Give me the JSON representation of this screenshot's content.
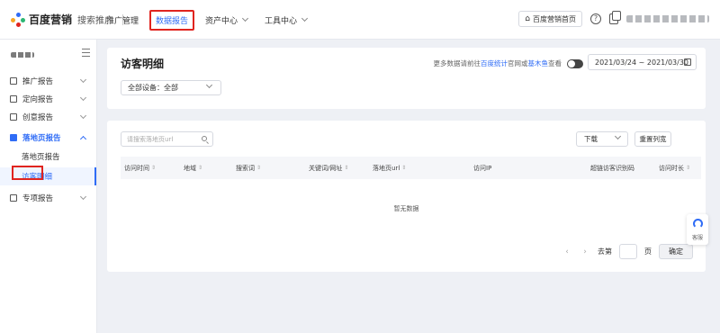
{
  "brand": {
    "name": "百度营销",
    "sub": "搜索推广",
    "colors": {
      "blue": "#2f6cf6",
      "red": "#e0241f",
      "green": "#2bb673",
      "orange": "#f6a623"
    }
  },
  "topnav": {
    "items": [
      {
        "label": "推广管理",
        "has_dropdown": false
      },
      {
        "label": "数据报告",
        "has_dropdown": false,
        "active": true
      },
      {
        "label": "资产中心",
        "has_dropdown": true
      },
      {
        "label": "工具中心",
        "has_dropdown": true
      }
    ],
    "home_label": "百度营销首页",
    "help_icon": "help-icon",
    "copy_icon": "copy-icon"
  },
  "sidebar": {
    "items": [
      {
        "label": "推广报告",
        "icon": "report-icon"
      },
      {
        "label": "定向报告",
        "icon": "target-icon"
      },
      {
        "label": "创意报告",
        "icon": "creative-icon"
      },
      {
        "label": "落地页报告",
        "icon": "landing-icon",
        "open": true
      },
      {
        "label": "专项报告",
        "icon": "special-icon"
      }
    ],
    "subitems": [
      {
        "label": "落地页报告"
      },
      {
        "label": "访客明细",
        "active": true
      }
    ]
  },
  "header": {
    "title": "访客明细",
    "tip_prefix": "更多数据请前往",
    "tip_link1": "百度统计",
    "tip_mid": "官网或",
    "tip_link2": "基木鱼",
    "tip_suffix": "查看",
    "date_range": "2021/03/24 ~ 2021/03/30",
    "device_select": "全部设备：全部"
  },
  "table": {
    "search_placeholder": "请搜索落地页url",
    "download_label": "下载",
    "reset_label": "重置列宽",
    "columns": [
      "访问时间",
      "地域",
      "搜索词",
      "关键词/网址",
      "落地页url",
      "访问IP",
      "超链访客识别码",
      "访问时长"
    ],
    "empty_text": "暂无数据"
  },
  "pagination": {
    "goto_label": "去第",
    "page_unit": "页",
    "confirm_label": "确定"
  },
  "support": {
    "label": "客服"
  }
}
